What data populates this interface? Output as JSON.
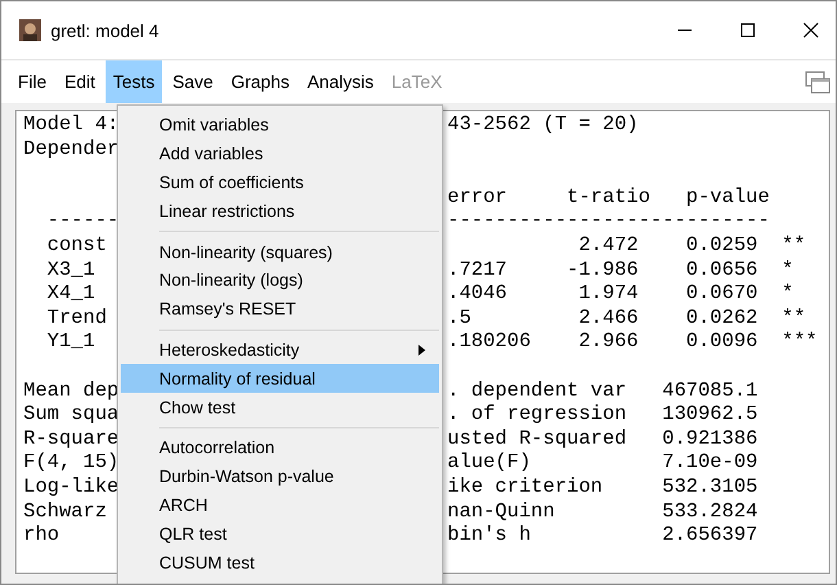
{
  "window": {
    "title": "gretl: model 4"
  },
  "menu_bar": [
    {
      "label": "File",
      "selected": false,
      "disabled": false
    },
    {
      "label": "Edit",
      "selected": false,
      "disabled": false
    },
    {
      "label": "Tests",
      "selected": true,
      "disabled": false
    },
    {
      "label": "Save",
      "selected": false,
      "disabled": false
    },
    {
      "label": "Graphs",
      "selected": false,
      "disabled": false
    },
    {
      "label": "Analysis",
      "selected": false,
      "disabled": false
    },
    {
      "label": "LaTeX",
      "selected": false,
      "disabled": true
    }
  ],
  "output_lines": [
    {
      "kind": "text",
      "left": "Model 4:",
      "right": "43-2562 (T = 20)"
    },
    {
      "kind": "text",
      "left": "Depender"
    },
    {
      "kind": "blank"
    },
    {
      "kind": "text",
      "right": "error     t-ratio   p-value"
    },
    {
      "kind": "text",
      "left": "  ------",
      "right": "---------------------------"
    },
    {
      "kind": "text",
      "left": "  const",
      "right": "           2.472    0.0259  **"
    },
    {
      "kind": "text",
      "left": "  X3_1",
      "right": ".7217     -1.986    0.0656  *"
    },
    {
      "kind": "text",
      "left": "  X4_1",
      "right": ".4046      1.974    0.0670  *"
    },
    {
      "kind": "text",
      "left": "  Trend",
      "right": ".5         2.466    0.0262  **"
    },
    {
      "kind": "text",
      "left": "  Y1_1",
      "right": ".180206    2.966    0.0096  ***"
    },
    {
      "kind": "blank"
    },
    {
      "kind": "text",
      "left": "Mean dep",
      "right": ". dependent var   467085.1"
    },
    {
      "kind": "text",
      "left": "Sum squa",
      "right": ". of regression   130962.5"
    },
    {
      "kind": "text",
      "left": "R-square",
      "right": "usted R-squared   0.921386"
    },
    {
      "kind": "text",
      "left": "F(4, 15)",
      "right": "alue(F)           7.10e-09"
    },
    {
      "kind": "text",
      "left": "Log-like",
      "right": "ike criterion     532.3105"
    },
    {
      "kind": "text",
      "left": "Schwarz",
      "right": "nan-Quinn         533.2824"
    },
    {
      "kind": "text",
      "left": "rho",
      "right": "bin's h           2.656397"
    }
  ],
  "tests_menu": [
    {
      "kind": "item",
      "label": "Omit variables",
      "selected": false,
      "submenu": false
    },
    {
      "kind": "item",
      "label": "Add variables",
      "selected": false,
      "submenu": false
    },
    {
      "kind": "item",
      "label": "Sum of coefficients",
      "selected": false,
      "submenu": false
    },
    {
      "kind": "item",
      "label": "Linear restrictions",
      "selected": false,
      "submenu": false
    },
    {
      "kind": "separator"
    },
    {
      "kind": "item",
      "label": "Non-linearity (squares)",
      "selected": false,
      "submenu": false
    },
    {
      "kind": "item",
      "label": "Non-linearity (logs)",
      "selected": false,
      "submenu": false
    },
    {
      "kind": "item",
      "label": "Ramsey's RESET",
      "selected": false,
      "submenu": false
    },
    {
      "kind": "separator"
    },
    {
      "kind": "item",
      "label": "Heteroskedasticity",
      "selected": false,
      "submenu": true
    },
    {
      "kind": "item",
      "label": "Normality of residual",
      "selected": true,
      "submenu": false
    },
    {
      "kind": "item",
      "label": "Chow test",
      "selected": false,
      "submenu": false
    },
    {
      "kind": "separator"
    },
    {
      "kind": "item",
      "label": "Autocorrelation",
      "selected": false,
      "submenu": false
    },
    {
      "kind": "item",
      "label": "Durbin-Watson p-value",
      "selected": false,
      "submenu": false
    },
    {
      "kind": "item",
      "label": "ARCH",
      "selected": false,
      "submenu": false
    },
    {
      "kind": "item",
      "label": "QLR test",
      "selected": false,
      "submenu": false
    },
    {
      "kind": "item",
      "label": "CUSUM test",
      "selected": false,
      "submenu": false
    }
  ]
}
